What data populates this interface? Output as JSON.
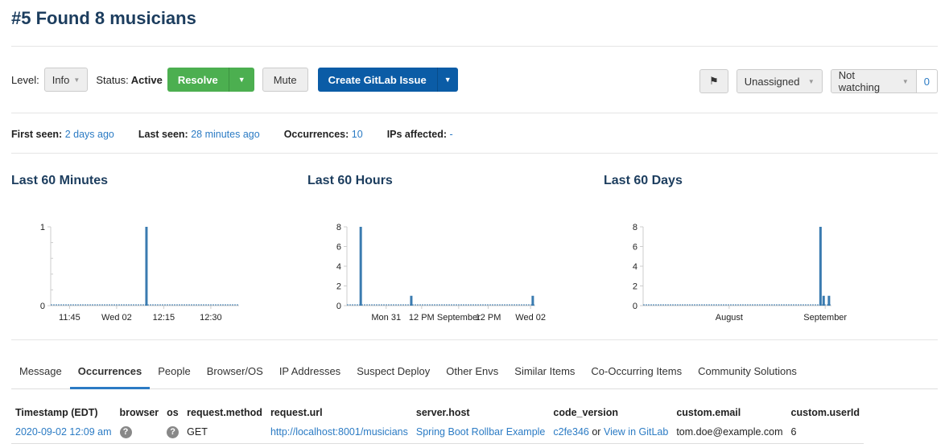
{
  "title": "#5 Found 8 musicians",
  "toolbar": {
    "level_label": "Level:",
    "level_value": "Info",
    "status_label": "Status:",
    "status_value": "Active",
    "resolve": "Resolve",
    "mute": "Mute",
    "create_issue": "Create GitLab Issue",
    "assignee": "Unassigned",
    "watch": "Not watching",
    "watch_count": "0"
  },
  "stats": {
    "first_seen_label": "First seen:",
    "first_seen": "2 days ago",
    "last_seen_label": "Last seen:",
    "last_seen": "28 minutes ago",
    "occurrences_label": "Occurrences:",
    "occurrences": "10",
    "ips_label": "IPs affected:",
    "ips": "-"
  },
  "chart_data": [
    {
      "type": "bar",
      "title": "Last 60 Minutes",
      "xrange": [
        0,
        60
      ],
      "ylim": [
        0,
        1
      ],
      "yticks": [
        0,
        1
      ],
      "minor_yticks": [
        0.2,
        0.4,
        0.6,
        0.8
      ],
      "xticks": [
        {
          "x": 6,
          "label": "11:45"
        },
        {
          "x": 21,
          "label": "Wed 02"
        },
        {
          "x": 36,
          "label": "12:15"
        },
        {
          "x": 51,
          "label": "12:30"
        }
      ],
      "bars": [
        {
          "x": 30.5,
          "value": 1
        }
      ]
    },
    {
      "type": "bar",
      "title": "Last 60 Hours",
      "xrange": [
        0,
        60
      ],
      "ylim": [
        0,
        8
      ],
      "yticks": [
        0,
        2,
        4,
        6,
        8
      ],
      "minor_yticks": [],
      "xticks": [
        {
          "x": 12.5,
          "label": "Mon 31"
        },
        {
          "x": 23.8,
          "label": "12 PM"
        },
        {
          "x": 35.6,
          "label": "September"
        },
        {
          "x": 45,
          "label": "12 PM"
        },
        {
          "x": 58.5,
          "label": "Wed 02"
        }
      ],
      "bars": [
        {
          "x": 4.4,
          "value": 8
        },
        {
          "x": 20.5,
          "value": 1
        },
        {
          "x": 59.2,
          "value": 1
        }
      ]
    },
    {
      "type": "bar",
      "title": "Last 60 Days",
      "xrange": [
        0,
        60
      ],
      "ylim": [
        0,
        8
      ],
      "yticks": [
        0,
        2,
        4,
        6,
        8
      ],
      "minor_yticks": [],
      "xticks": [
        {
          "x": 27.4,
          "label": "August"
        },
        {
          "x": 58,
          "label": "September"
        }
      ],
      "bars": [
        {
          "x": 56.5,
          "value": 8
        },
        {
          "x": 57.5,
          "value": 1
        },
        {
          "x": 59.2,
          "value": 1
        }
      ]
    }
  ],
  "tabs": [
    "Message",
    "Occurrences",
    "People",
    "Browser/OS",
    "IP Addresses",
    "Suspect Deploy",
    "Other Envs",
    "Similar Items",
    "Co-Occurring Items",
    "Community Solutions"
  ],
  "table": {
    "headers": [
      "Timestamp (EDT)",
      "browser",
      "os",
      "request.method",
      "request.url",
      "server.host",
      "code_version",
      "custom.email",
      "custom.userId"
    ],
    "row": {
      "timestamp": "2020-09-02 12:09 am",
      "browser": "?",
      "os": "?",
      "method": "GET",
      "url": "http://localhost:8001/musicians",
      "host": "Spring Boot Rollbar Example",
      "code_version": "c2fe346",
      "or": "or",
      "gitlab": "View in GitLab",
      "email": "tom.doe@example.com",
      "userid": "6"
    }
  },
  "colors": {
    "bar": "#3a7bb0",
    "accent": "#2b7bc4",
    "green": "#4caf50",
    "blue": "#0b5ca6"
  }
}
